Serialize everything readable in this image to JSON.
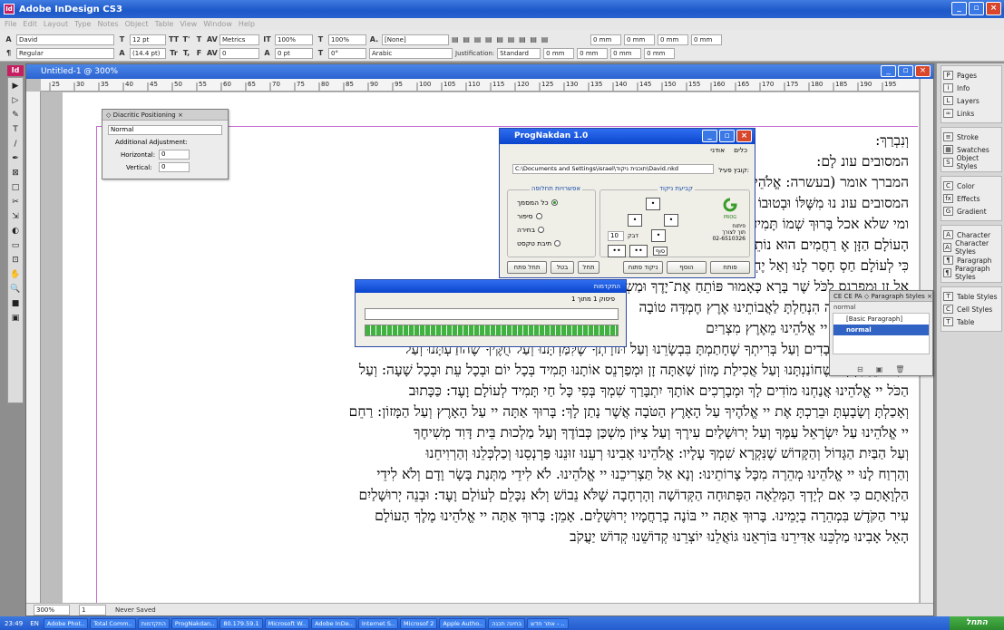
{
  "app": {
    "title": "Adobe InDesign CS3",
    "icon": "Id"
  },
  "window_buttons": [
    "_",
    "▫",
    "×"
  ],
  "menu": [
    "File",
    "Edit",
    "Layout",
    "Type",
    "Notes",
    "Object",
    "Table",
    "View",
    "Window",
    "Help"
  ],
  "control": {
    "font": "David",
    "style": "Regular",
    "size": "12 pt",
    "leading": "(14.4 pt)",
    "kerning": "Metrics",
    "vscale": "100%",
    "hscale": "100%",
    "tracking": "0",
    "baseline": "0 pt",
    "skew": "0°",
    "charstyle": "[None]",
    "language": "Arabic",
    "justification_label": "Justification:",
    "justification": "Standard",
    "indent": "0 mm"
  },
  "document": {
    "title": "Untitled-1 @ 300%",
    "zoom": "300%",
    "page": "1",
    "status": "Never Saved"
  },
  "ruler_ticks": [
    "25",
    "30",
    "35",
    "40",
    "45",
    "50",
    "55",
    "60",
    "65",
    "70",
    "75",
    "80",
    "85",
    "90",
    "95",
    "100",
    "105",
    "110",
    "115",
    "120",
    "125",
    "130",
    "135",
    "140",
    "145",
    "150",
    "155",
    "160",
    "165",
    "170",
    "175",
    "180",
    "185",
    "190",
    "195"
  ],
  "body_lines": [
    "וְנִבְרַךְ:",
    "המסובים עונ                                                           לָם:",
    "המברך אומר                                      (בעשרה: אֱלֹהֵינוּ) שֶׁאָכַלְנוּ מִשֶּׁלּוֹ:",
    "המסובים עונ                                               נוּ מִשֶּׁלּוֹ וּבְטוּבוֹ חָיִינוּ:",
    "ומי שלא אכל                         בָּרוּךְ שְׁמוֹ תָּמִיד לְעוֹלָם וָעֶד: בָּרוּךְ אַתָּה יי אֱלֹהֵינוּ מֶלֶךְ",
    "הָעוֹלָם הַזָּן אֶ                          רַחֲמִים הוּא נוֹתֵן לֶחֶם לְכָל בָּשָׂר",
    "כִּי לְעוֹלָם חַסְ                        חָסַר לָנוּ וְאַל יֶחְסַר לָנוּ מָזוֹן לְעוֹלָם וָעֶד: בַּעֲבוּר שְׁמוֹ הַגָּדוֹל",
    "אֵל זָן וּמְפַרְנֵס לַכֹּל                          שֶׁר בָּרָא כָּאָמוּר פּוֹתֵחַ אֶת־יָדֶךָ וּמַשְׂבִּיעַ",
    "רָצוֹן: בָּרוּךְ אַתָּה                                  הִנְחַלְתָּ לַאֲבוֹתֵינוּ אֶרֶץ חֶמְדָּה טוֹבָה",
    "וְעַל שֶׁהוֹצֵאתָנוּ יי אֱלֹהֵינוּ מֵאֶרֶץ מִצְרַיִם",
    "פְּדִיתָנוּ מִבֵּית עֲבָדִים וְעַל בְּרִיתְךָ שֶׁחָתַמְתָּ בִּבְשָׂרֵנוּ וְעַל תּוֹרָתְךָ שֶׁלִּמַּדְתָּנוּ וְעַל חֻקֶּיךָ שֶׁהוֹדַעְתָּנוּ וְעַל",
    "חַיִּים חֵן וָחֶסֶד שֶׁחוֹנַנְתָּנוּ וְעַל אֲכִילַת מָזוֹן שָׁאַתָּה זָן וּמְפַרְנֵס אוֹתָנוּ תָּמִיד בְּכָל יוֹם וּבְכָל עֵת וּבְכָל שָׁעָה: וְעַל",
    "הַכֹּל יי אֱלֹהֵינוּ אֲנַחְנוּ מוֹדִים לָךְ וּמְבָרְכִים אוֹתָךְ יִתְבָּרַךְ שִׁמְךָ בְּפִי כָּל חַי תָּמִיד לְעוֹלָם וָעֶד: כַּכָּתוּב",
    "וְאָכַלְתָּ וְשָׂבָעְתָּ וּבֵרַכְתָּ אֶת יי אֱלֹהֶיךָ עַל הָאָרֶץ הַטֹּבָה אֲשֶׁר נָתַן לָךְ: בָּרוּךְ אַתָּה יי עַל הָאָרֶץ וְעַל הַמָּזוֹן: רַחֵם",
    "יי אֱלֹהֵינוּ עַל יִשְׂרָאֵל עַמֶּךָ וְעַל יְרוּשָׁלַיִם עִירֶךָ וְעַל צִיּוֹן מִשְׁכַּן כְּבוֹדֶךָ וְעַל מַלְכוּת בֵּית דָּוִד מְשִׁיחֶךָ",
    "וְעַל הַבַּיִת הַגָּדוֹל וְהַקָּדוֹשׁ שֶׁנִּקְרָא שִׁמְךָ עָלָיו: אֱלֹהֵינוּ אָבִינוּ רְעֵנוּ זוּנֵנוּ פַּרְנְסֵנוּ וְכַלְכְּלֵנוּ וְהַרְוִיחֵנוּ",
    "וְהַרְוַח לָנוּ יי אֱלֹהֵינוּ מְהֵרָה מִכָּל צָרוֹתֵינוּ: וְנָא אַל תַּצְרִיכֵנוּ יי אֱלֹהֵינוּ. לֹא לִידֵי מַתְּנַת בָּשָׂר וָדָם וְלֹא לִידֵי",
    "הַלְוָאָתָם כִּי אִם לְיָדְךָ הַמְּלֵאָה הַפְּתוּחָה הַקְּדוֹשָׁה וְהָרְחָבָה שֶׁלֹּא נֵבוֹשׁ וְלֹא נִכָּלֵם לְעוֹלָם וָעֶד: וּבְנֵה יְרוּשָׁלַיִם",
    "עִיר הַקֹּדֶשׁ בִּמְהֵרָה בְיָמֵינוּ. בָּרוּךְ אַתָּה יי בּוֹנֶה בְרַחֲמָיו יְרוּשָׁלָיִם. אָמֵן: בָּרוּךְ אַתָּה יי אֱלֹהֵינוּ מֶלֶךְ הָעוֹלָם",
    "הָאֵל אָבִינוּ מַלְכֵּנוּ אַדִּירֵנוּ בּוֹרְאֵנוּ גּוֹאֲלֵנוּ יוֹצְרֵנוּ קְדוֹשֵׁנוּ קְדוֹשׁ יַעֲקֹב"
  ],
  "diacritic": {
    "tab": "◇ Diacritic Positioning ×",
    "mode": "Normal",
    "adjust_label": "Additional Adjustment:",
    "h_label": "Horizontal:",
    "h_value": "0",
    "v_label": "Vertical:",
    "v_value": "0"
  },
  "prognakdan": {
    "title": "ProgNakdan 1.0",
    "menu": [
      "כלים",
      "אודני"
    ],
    "path_label": "קובץ פעיל:",
    "path": "C:\\Documents and Settings\\israel\\תוכנית ניקוד\\David.nkd",
    "grp_modes": "אפשרויות תחלופה",
    "modes": [
      {
        "label": "כל המסמך",
        "on": true
      },
      {
        "label": "סיפור",
        "on": false
      },
      {
        "label": "בחירה",
        "on": false
      },
      {
        "label": "תיבת טקסט",
        "on": false
      }
    ],
    "grp_nikud": "קביעת ניקוד",
    "logo_caption": "PROG",
    "company": [
      "פיתוח",
      "תוך לצורך",
      "02-6510326"
    ],
    "input_val": "10",
    "label_word": "דבק",
    "label_sof": "סוף",
    "btns_right": [
      "פותח",
      "הוסף",
      "ניקוד פתוח"
    ],
    "btns_left": [
      "תחל",
      "בטל",
      "תחל פתח"
    ]
  },
  "progress": {
    "title": "התקדמות",
    "label": "פיסוק",
    "count": "1  מתוך  1",
    "bar1": 0,
    "bar2": 1
  },
  "para_styles": {
    "tabs": "CE CE PA ◇ Paragraph Styles ×",
    "current": "normal",
    "items": [
      {
        "label": "[Basic Paragraph]",
        "sel": false
      },
      {
        "label": "normal",
        "sel": true
      }
    ]
  },
  "panels": [
    [
      {
        "icon": "P",
        "label": "Pages"
      },
      {
        "icon": "i",
        "label": "Info"
      },
      {
        "icon": "L",
        "label": "Layers"
      },
      {
        "icon": "∞",
        "label": "Links"
      }
    ],
    [
      {
        "icon": "≡",
        "label": "Stroke"
      },
      {
        "icon": "▦",
        "label": "Swatches"
      },
      {
        "icon": "S",
        "label": "Object Styles"
      }
    ],
    [
      {
        "icon": "C",
        "label": "Color"
      },
      {
        "icon": "fx",
        "label": "Effects"
      },
      {
        "icon": "G",
        "label": "Gradient"
      }
    ],
    [
      {
        "icon": "A",
        "label": "Character"
      },
      {
        "icon": "A",
        "label": "Character Styles"
      },
      {
        "icon": "¶",
        "label": "Paragraph"
      },
      {
        "icon": "¶",
        "label": "Paragraph Styles"
      }
    ],
    [
      {
        "icon": "T",
        "label": "Table Styles"
      },
      {
        "icon": "C",
        "label": "Cell Styles"
      },
      {
        "icon": "T",
        "label": "Table"
      }
    ]
  ],
  "tools": [
    "▶",
    "▷",
    "✎",
    "T",
    "/",
    "✒",
    "⊠",
    "□",
    "✂",
    "⇲",
    "◐",
    "▭",
    "⊡",
    "✋",
    "🔍",
    "■",
    "▣"
  ],
  "taskbar": {
    "clock": "23:49",
    "lang": "EN",
    "start": "התחל",
    "tasks": [
      "Adobe Phot..",
      "Total Comm..",
      "התקדמות",
      "ProgNakdan..",
      "80.179.59.1",
      "Microsoft W..",
      "Adobe InDe..",
      "Internet S..",
      "Microsof 2",
      "Apple Autho..",
      "בחינה תכנה",
      "אתר חדש - .."
    ]
  }
}
